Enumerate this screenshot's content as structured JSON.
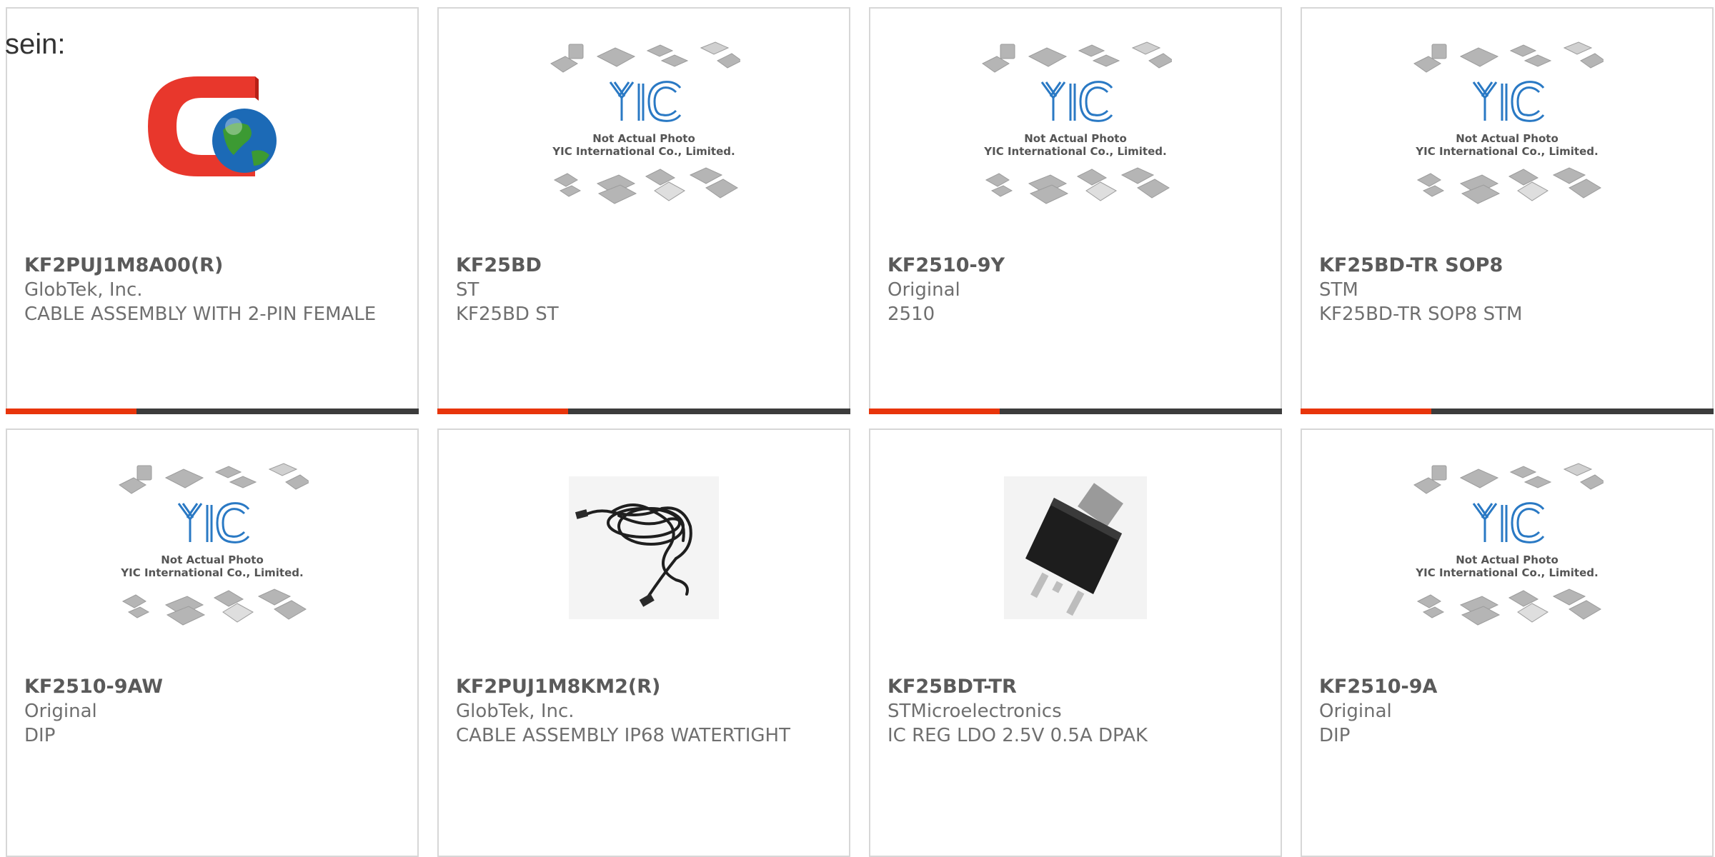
{
  "intro_text": "sein:",
  "colors": {
    "accent": "#e8350b",
    "bar": "#3c3c3c",
    "border": "#d7d7d7",
    "text": "#6f6f6f"
  },
  "products": [
    {
      "part": "KF2PUJ1M8A00(R)",
      "maker": "GlobTek, Inc.",
      "desc": "CABLE ASSEMBLY WITH 2-PIN FEMALE",
      "image": "globtek-logo"
    },
    {
      "part": "KF25BD",
      "maker": "ST",
      "desc": "KF25BD ST",
      "image": "yic-not-actual-photo"
    },
    {
      "part": "KF2510-9Y",
      "maker": "Original",
      "desc": "2510",
      "image": "yic-not-actual-photo"
    },
    {
      "part": "KF25BD-TR SOP8",
      "maker": "STM",
      "desc": "KF25BD-TR SOP8 STM",
      "image": "yic-not-actual-photo"
    },
    {
      "part": "KF2510-9AW",
      "maker": "Original",
      "desc": "DIP",
      "image": "yic-not-actual-photo"
    },
    {
      "part": "KF2PUJ1M8KM2(R)",
      "maker": "GlobTek, Inc.",
      "desc": "CABLE ASSEMBLY IP68 WATERTIGHT",
      "image": "cable-photo"
    },
    {
      "part": "KF25BDT-TR",
      "maker": "STMicroelectronics",
      "desc": "IC REG LDO 2.5V 0.5A DPAK",
      "image": "dpak-chip-photo"
    },
    {
      "part": "KF2510-9A",
      "maker": "Original",
      "desc": "DIP",
      "image": "yic-not-actual-photo"
    }
  ],
  "yic_placeholder": {
    "line1": "Not Actual Photo",
    "line2": "YIC International Co., Limited."
  }
}
